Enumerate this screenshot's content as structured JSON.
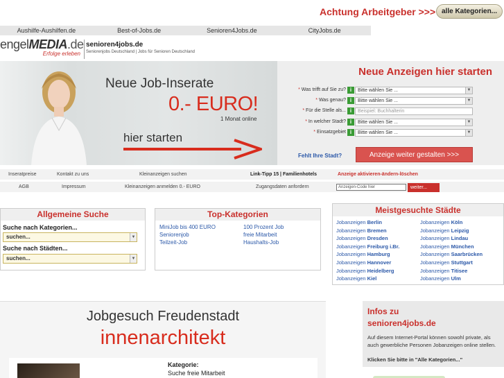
{
  "alert": {
    "text": "Achtung Arbeitgeber >>>",
    "button": "alle Kategorien..."
  },
  "network": [
    "Aushilfe-Aushilfen.de",
    "Best-of-Jobs.de",
    "Senioren4Jobs.de",
    "CityJobs.de"
  ],
  "logo": {
    "prefix": "engel",
    "brand": "MEDIA",
    "suffix": ".de",
    "tagline": "Erfolge erleben"
  },
  "site": {
    "name": "senioren4jobs.de",
    "tag": "Seniorenjobs Deutschland | Jobs für Senioren Deutschland"
  },
  "hero": {
    "headline": "Neue Job-Inserate",
    "price": "0.- EURO!",
    "duration": "1 Monat online",
    "cta": "hier starten"
  },
  "form": {
    "title": "Neue Anzeigen hier starten",
    "rows": [
      {
        "label": "Was trifft auf Sie zu?",
        "value": "Bitte wählen Sie ..."
      },
      {
        "label": "Was genau?",
        "value": "Bitte wählen Sie ..."
      },
      {
        "label": "Für die Stelle als...",
        "placeholder": "Beispiel: Buchhalterin"
      },
      {
        "label": "In welcher Stadt?",
        "value": "Bitte wählen Sie ..."
      },
      {
        "label": "Einsatzgebiet",
        "value": "Bitte wählen Sie ..."
      }
    ],
    "missing_city": "Fehlt Ihre Stadt?",
    "continue": "Anzeige weiter gestalten >>>"
  },
  "subnav": {
    "row1": [
      "Inseratpreise",
      "Kontakt zu uns",
      "Kleinanzeigen suchen",
      "Link-Tipp 15 | Familienhotels",
      "Anzeige aktivieren-ändern-löschen"
    ],
    "row2": [
      "AGB",
      "Impressum",
      "Kleinanzeigen anmelden 0.- EURO",
      "Zugangsdaten anfordern"
    ],
    "code_placeholder": "Anzeigen-Code hier",
    "code_button": "weiter..."
  },
  "search": {
    "title": "Allgemeine Suche",
    "cat_label": "Suche nach Kategorien...",
    "cat_value": "suchen...",
    "city_label": "Suche nach Städten...",
    "city_value": "suchen..."
  },
  "top": {
    "title": "Top-Kategorien",
    "col1": [
      "MiniJob bis 400 EURO",
      "Seniorenjob",
      "Teilzeit-Job"
    ],
    "col2": [
      "100 Prozent Job",
      "freie Mitarbeit",
      "Haushalts-Job"
    ]
  },
  "cities": {
    "title": "Meistgesuchte Städte",
    "prefix": "Jobanzeigen",
    "col1": [
      "Berlin",
      "Bremen",
      "Dresden",
      "Freiburg i.Br.",
      "Hamburg",
      "Hannover",
      "Heidelberg",
      "Kiel"
    ],
    "col2": [
      "Köln",
      "Leipzig",
      "Lindau",
      "München",
      "Saarbrücken",
      "Stuttgart",
      "Titisee",
      "Ulm"
    ]
  },
  "job": {
    "title": "Jobgesuch Freudenstadt",
    "keyword": "innenarchitekt",
    "cat_label": "Kategorie:",
    "cat_value": "Suche freie Mitarbeit"
  },
  "info": {
    "title1": "Infos zu",
    "title2": "senioren4jobs.de",
    "text": "Auf diesem Internet-Portal können sowohl private, als auch gewerbliche Personen Jobanzeigen online stellen.",
    "strong": "Klicken Sie bitte in \"Alle Kategorien...\""
  },
  "colors": {
    "accent_red": "#c9302c",
    "link_blue": "#2b58a8",
    "info_green": "#3a9b35"
  }
}
